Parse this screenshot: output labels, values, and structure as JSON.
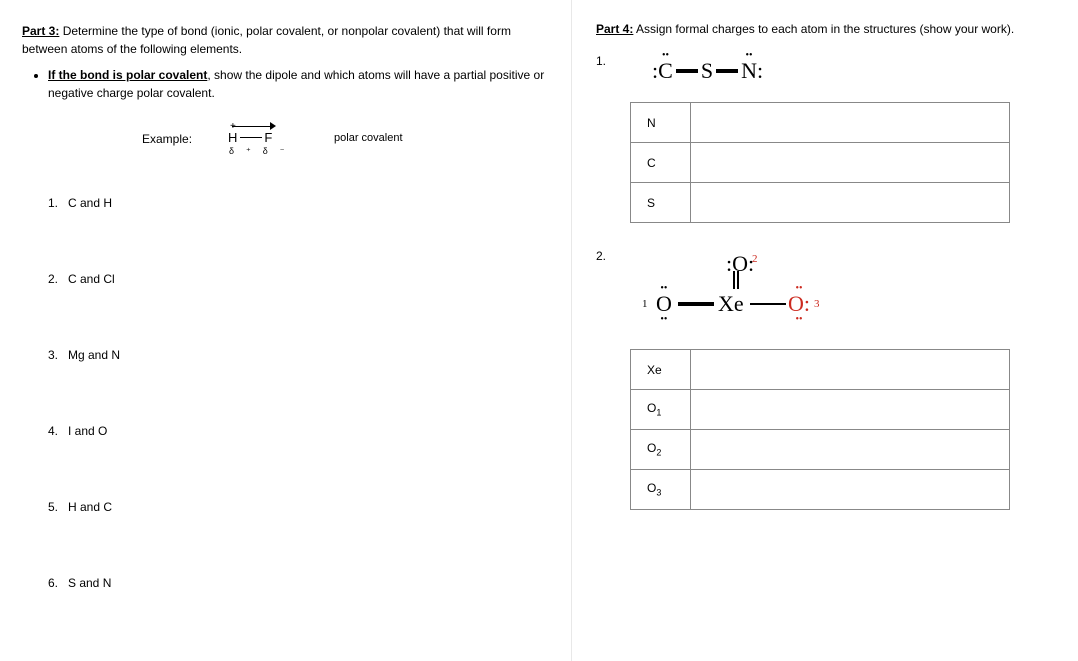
{
  "left": {
    "part_label": "Part 3:",
    "intro": "Determine the type of bond (ionic, polar covalent, or nonpolar covalent) that will form between atoms of the following elements.",
    "bullet_lead": "If the bond is polar covalent",
    "bullet_rest": ", show the dipole and which atoms will have a partial positive or negative charge polar covalent.",
    "example_label": "Example:",
    "hf_h": "H",
    "hf_f": "F",
    "hf_delta_plus": "δ⁺",
    "hf_delta_minus": "δ⁻",
    "polar_cov": "polar covalent",
    "questions": [
      {
        "n": "1.",
        "t": "C and H"
      },
      {
        "n": "2.",
        "t": "C and Cl"
      },
      {
        "n": "3.",
        "t": "Mg and N"
      },
      {
        "n": "4.",
        "t": "I and O"
      },
      {
        "n": "5.",
        "t": "H and C"
      },
      {
        "n": "6.",
        "t": "S and N"
      }
    ]
  },
  "right": {
    "part_label": "Part 4:",
    "intro": "Assign formal charges to each atom in the structures (show your work).",
    "p1_num": "1.",
    "p1_atoms": {
      "c": "C",
      "s": "S",
      "n": "N"
    },
    "p1_pairs": "••",
    "p1_colon": ":",
    "p1_rows": [
      {
        "lbl": "N"
      },
      {
        "lbl": "C"
      },
      {
        "lbl": "S"
      }
    ],
    "p2_num": "2.",
    "p2_atoms": {
      "xe": "Xe",
      "o": "O"
    },
    "p2_labels": {
      "n1": "1",
      "n2": "2",
      "n3": "3"
    },
    "p2_rows": [
      {
        "lbl": "Xe"
      },
      {
        "lbl": "O₁"
      },
      {
        "lbl": "O₂"
      },
      {
        "lbl": "O₃"
      }
    ]
  }
}
